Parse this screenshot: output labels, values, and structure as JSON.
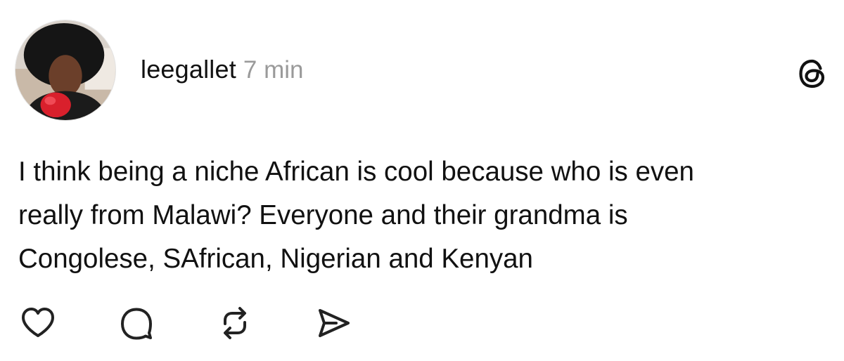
{
  "post": {
    "username": "leegallet",
    "timestamp": "7 min",
    "text_lines": [
      "I think being a niche African is cool because who is even",
      "really from Malawi? Everyone and their grandma is",
      "Congolese, SAfrican, Nigerian and Kenyan"
    ]
  },
  "icons": {
    "brand": "threads-logo-icon",
    "actions": [
      "heart-icon",
      "comment-icon",
      "repost-icon",
      "share-icon"
    ]
  },
  "colors": {
    "text": "#111111",
    "timestamp": "#9a9a9a",
    "icon_stroke": "#222222",
    "background": "#ffffff"
  }
}
